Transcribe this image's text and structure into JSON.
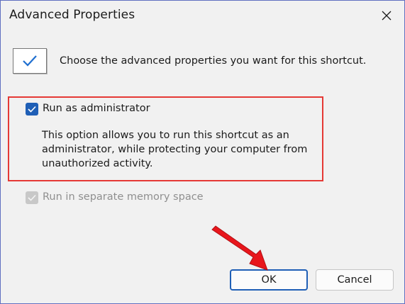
{
  "window": {
    "title": "Advanced Properties"
  },
  "header": {
    "text": "Choose the advanced properties you want for this shortcut."
  },
  "options": {
    "run_as_admin": {
      "label": "Run as administrator",
      "checked": true,
      "description": "This option allows you to run this shortcut as an administrator, while protecting your computer from unauthorized activity."
    },
    "separate_memory": {
      "label": "Run in separate memory space",
      "checked": true,
      "disabled": true
    }
  },
  "buttons": {
    "ok_label": "OK",
    "cancel_label": "Cancel"
  },
  "colors": {
    "accent": "#1f5fb6",
    "highlight": "#e53935",
    "arrow": "#e8161c"
  },
  "icons": {
    "close": "close-icon",
    "shortcut_check": "checkmark-icon",
    "arrow": "red-arrow-annotation"
  }
}
